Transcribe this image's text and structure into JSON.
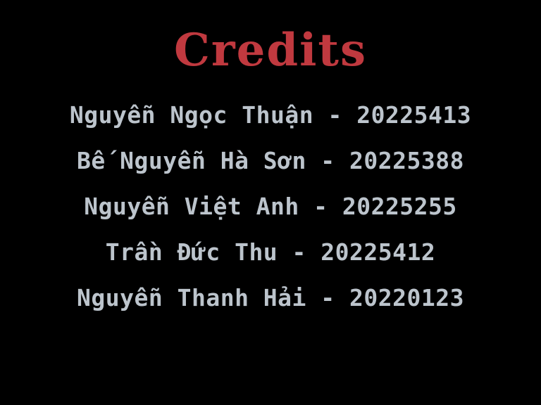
{
  "screen": {
    "title": "Credits",
    "background_color": "#000000",
    "title_color": "#c0393f",
    "text_color": "#bcc4cc",
    "credits": [
      "Nguyễn Ngọc Thuận - 20225413",
      "Bế Nguyễn Hà Sơn - 20225388",
      "Nguyễn Việt Anh - 20225255",
      "Trần Đức Thu - 20225412",
      "Nguyễn Thanh Hải - 20220123"
    ]
  }
}
